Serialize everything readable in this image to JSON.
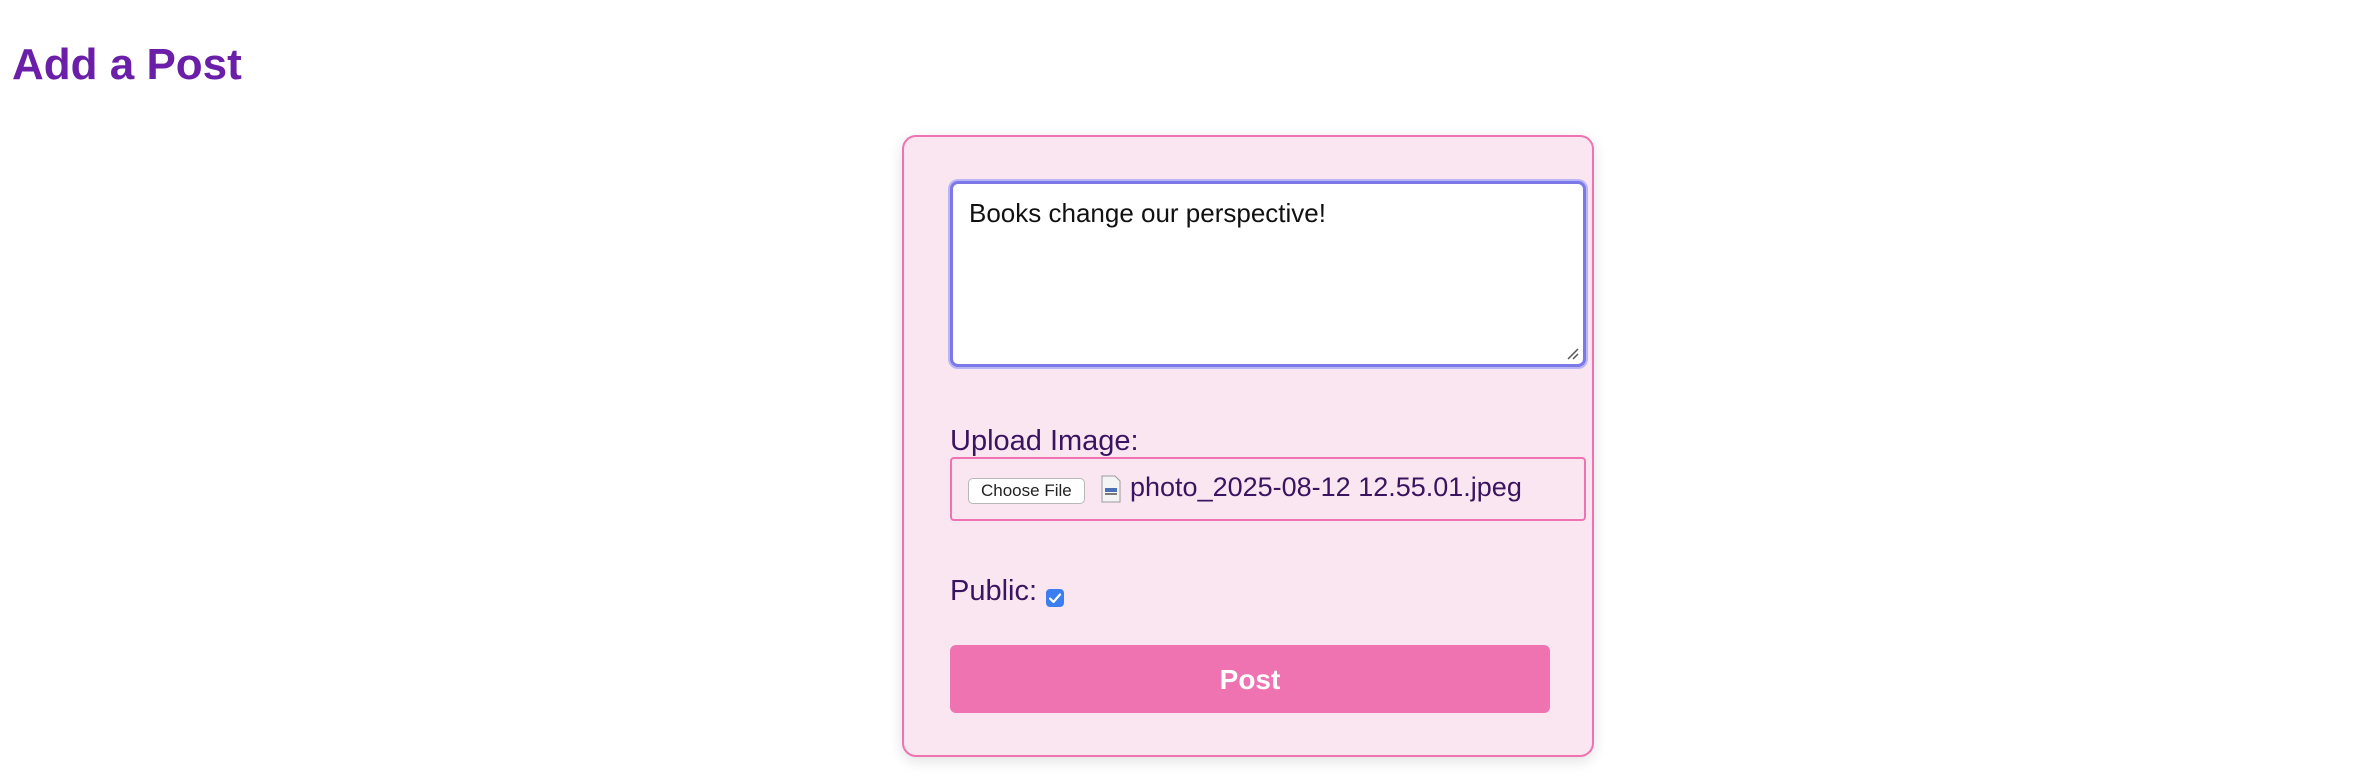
{
  "page": {
    "title": "Add a Post"
  },
  "form": {
    "post_text": "Books change our perspective!",
    "upload_label": "Upload Image:",
    "choose_file_label": "Choose File",
    "file_name": "photo_2025-08-12 12.55.01.jpeg",
    "public_label": "Public:",
    "public_checked": true,
    "submit_label": "Post"
  },
  "icons": {
    "file": "file-icon",
    "checkbox": "checkmark-icon",
    "resize": "resize-handle-icon"
  },
  "colors": {
    "title": "#6b1fa8",
    "card_bg": "#fae6f0",
    "card_border": "#ef72b1",
    "accent": "#ef72b1",
    "focus_ring": "#7d78e8",
    "label_text": "#3a1460",
    "checkbox": "#3b7ef0"
  }
}
